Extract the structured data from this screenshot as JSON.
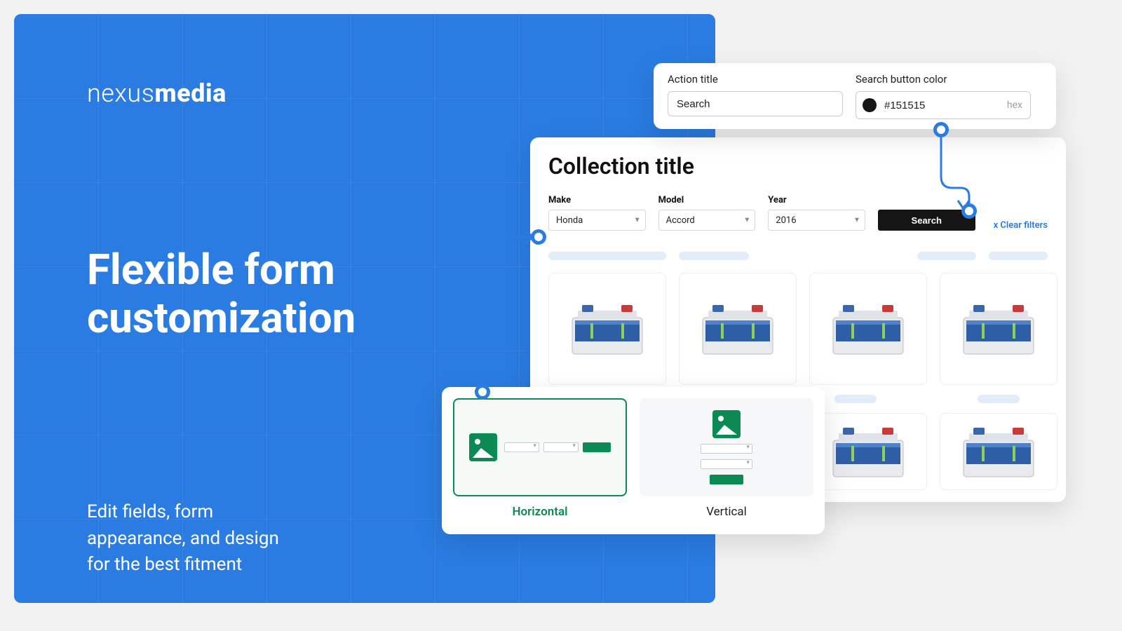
{
  "brand": {
    "thin": "nexus",
    "bold": "media"
  },
  "hero": {
    "headline_line1": "Flexible form",
    "headline_line2": "customization",
    "sub_line1": "Edit fields, form",
    "sub_line2": "appearance, and design",
    "sub_line3": "for the best fitment"
  },
  "settings": {
    "action_title_label": "Action title",
    "action_title_value": "Search",
    "color_label": "Search button color",
    "color_value": "#151515",
    "color_suffix": "hex"
  },
  "collection": {
    "title": "Collection title",
    "filters": {
      "make": {
        "label": "Make",
        "value": "Honda"
      },
      "model": {
        "label": "Model",
        "value": "Accord"
      },
      "year": {
        "label": "Year",
        "value": "2016"
      }
    },
    "search_button": "Search",
    "clear_filters": "x Clear filters"
  },
  "layout": {
    "horizontal": "Horizontal",
    "vertical": "Vertical",
    "selected": "horizontal"
  },
  "colors": {
    "primary_blue": "#2a7ce2",
    "search_button": "#151515",
    "accent_green": "#0b8a53"
  }
}
